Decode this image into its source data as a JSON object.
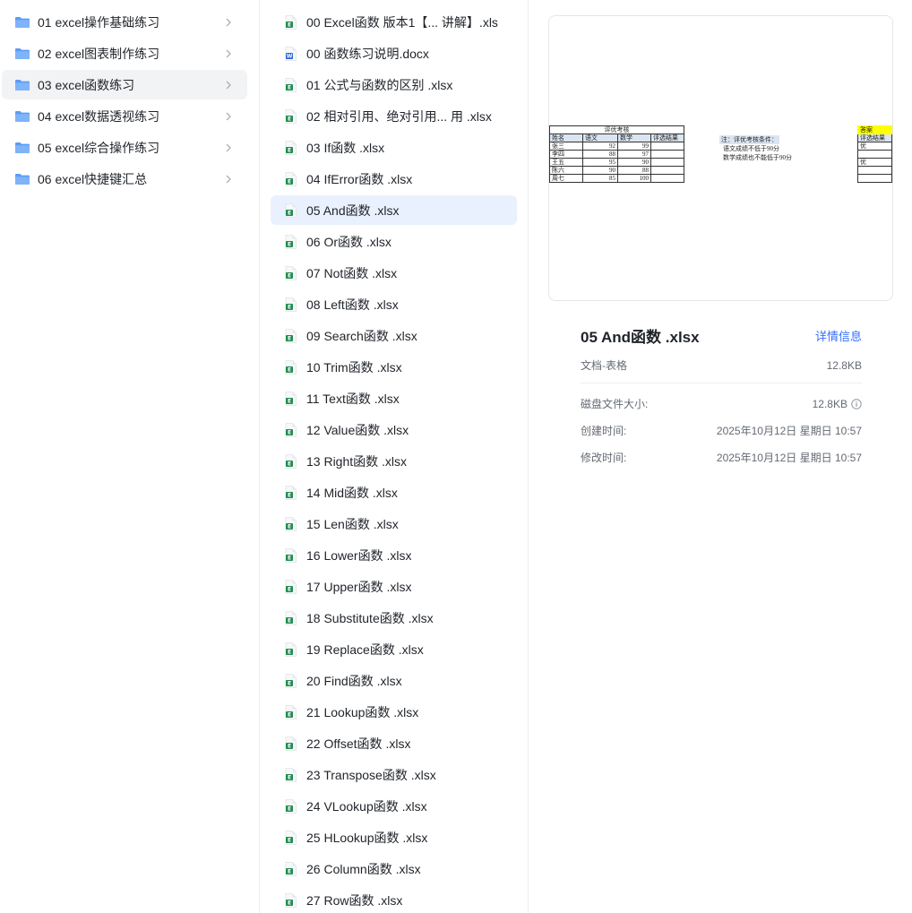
{
  "folders": [
    {
      "label": "01 excel操作基础练习"
    },
    {
      "label": "02 excel图表制作练习"
    },
    {
      "label": "03 excel函数练习"
    },
    {
      "label": "04 excel数据透视练习"
    },
    {
      "label": "05 excel综合操作练习"
    },
    {
      "label": "06 excel快捷键汇总"
    }
  ],
  "files": [
    {
      "label": "00 Excel函数 版本1【... 讲解】.xls",
      "type": "excel"
    },
    {
      "label": "00 函数练习说明.docx",
      "type": "word"
    },
    {
      "label": "01  公式与函数的区别 .xlsx",
      "type": "excel"
    },
    {
      "label": "02  相对引用、绝对引用...  用 .xlsx",
      "type": "excel"
    },
    {
      "label": "03  If函数 .xlsx",
      "type": "excel"
    },
    {
      "label": "04  IfError函数 .xlsx",
      "type": "excel"
    },
    {
      "label": "05  And函数 .xlsx",
      "type": "excel"
    },
    {
      "label": "06  Or函数 .xlsx",
      "type": "excel"
    },
    {
      "label": "07  Not函数 .xlsx",
      "type": "excel"
    },
    {
      "label": "08  Left函数 .xlsx",
      "type": "excel"
    },
    {
      "label": "09  Search函数 .xlsx",
      "type": "excel"
    },
    {
      "label": "10 Trim函数 .xlsx",
      "type": "excel"
    },
    {
      "label": "11 Text函数 .xlsx",
      "type": "excel"
    },
    {
      "label": "12 Value函数 .xlsx",
      "type": "excel"
    },
    {
      "label": "13  Right函数 .xlsx",
      "type": "excel"
    },
    {
      "label": "14  Mid函数 .xlsx",
      "type": "excel"
    },
    {
      "label": "15  Len函数 .xlsx",
      "type": "excel"
    },
    {
      "label": "16  Lower函数 .xlsx",
      "type": "excel"
    },
    {
      "label": "17  Upper函数 .xlsx",
      "type": "excel"
    },
    {
      "label": "18  Substitute函数 .xlsx",
      "type": "excel"
    },
    {
      "label": "19  Replace函数 .xlsx",
      "type": "excel"
    },
    {
      "label": "20  Find函数 .xlsx",
      "type": "excel"
    },
    {
      "label": "21  Lookup函数 .xlsx",
      "type": "excel"
    },
    {
      "label": "22  Offset函数 .xlsx",
      "type": "excel"
    },
    {
      "label": "23 Transpose函数 .xlsx",
      "type": "excel"
    },
    {
      "label": "24  VLookup函数 .xlsx",
      "type": "excel"
    },
    {
      "label": "25  HLookup函数 .xlsx",
      "type": "excel"
    },
    {
      "label": "26  Column函数 .xlsx",
      "type": "excel"
    },
    {
      "label": "27  Row函数 .xlsx",
      "type": "excel"
    }
  ],
  "selected_folder_index": 2,
  "selected_file_index": 6,
  "preview": {
    "table_title": "评优考核",
    "headers": [
      "姓名",
      "语文",
      "数学",
      "评选结果"
    ],
    "rows": [
      [
        "张三",
        "92",
        "99",
        ""
      ],
      [
        "李四",
        "88",
        "97",
        ""
      ],
      [
        "王五",
        "95",
        "90",
        ""
      ],
      [
        "陈六",
        "90",
        "88",
        ""
      ],
      [
        "周七",
        "85",
        "100",
        ""
      ]
    ],
    "note_title": "注：评优考核条件：",
    "note_lines": [
      "语文成绩不低于90分",
      "数学成绩也不能低于90分"
    ],
    "answer_label": "答案",
    "answer_header": "评选结果",
    "answer_values": [
      "优",
      "",
      "优",
      "",
      ""
    ]
  },
  "detail": {
    "title": "05  And函数 .xlsx",
    "details_link": "详情信息",
    "type_label": "文档-表格",
    "size": "12.8KB",
    "disk_size_label": "磁盘文件大小:",
    "disk_size": "12.8KB",
    "created_label": "创建时间:",
    "created": "2025年10月12日 星期日 10:57",
    "modified_label": "修改时间:",
    "modified": "2025年10月12日 星期日 10:57"
  },
  "colors": {
    "folder": "#5b9cf6",
    "excel": "#1e8c4e",
    "word": "#2b62d9",
    "accent": "#3370ff"
  }
}
